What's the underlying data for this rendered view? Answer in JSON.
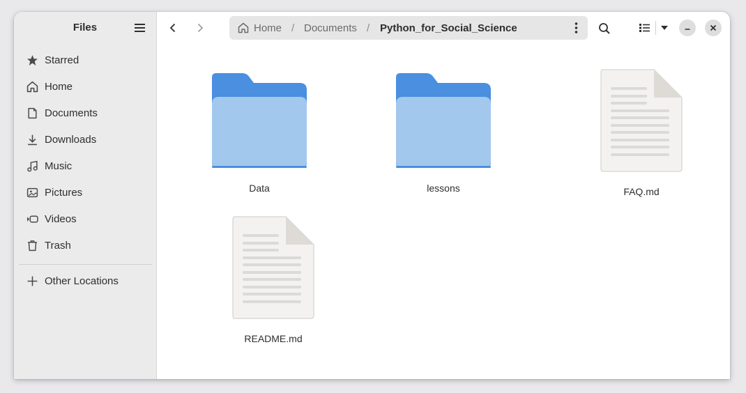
{
  "sidebar": {
    "title": "Files",
    "places": [
      {
        "label": "Starred",
        "icon": "star-icon"
      },
      {
        "label": "Home",
        "icon": "home-icon"
      },
      {
        "label": "Documents",
        "icon": "document-icon"
      },
      {
        "label": "Downloads",
        "icon": "download-icon"
      },
      {
        "label": "Music",
        "icon": "music-icon"
      },
      {
        "label": "Pictures",
        "icon": "picture-icon"
      },
      {
        "label": "Videos",
        "icon": "video-icon"
      },
      {
        "label": "Trash",
        "icon": "trash-icon"
      }
    ],
    "other_locations": "Other Locations"
  },
  "pathbar": {
    "home": "Home",
    "documents": "Documents",
    "current": "Python_for_Social_Science",
    "separator": "/"
  },
  "files": [
    {
      "name": "Data",
      "type": "folder"
    },
    {
      "name": "lessons",
      "type": "folder"
    },
    {
      "name": "FAQ.md",
      "type": "text-file"
    },
    {
      "name": "README.md",
      "type": "text-file"
    }
  ],
  "colors": {
    "folder_back": "#4a8fe0",
    "folder_front": "#a3c8ee",
    "sidebar_bg": "#ebebeb"
  }
}
